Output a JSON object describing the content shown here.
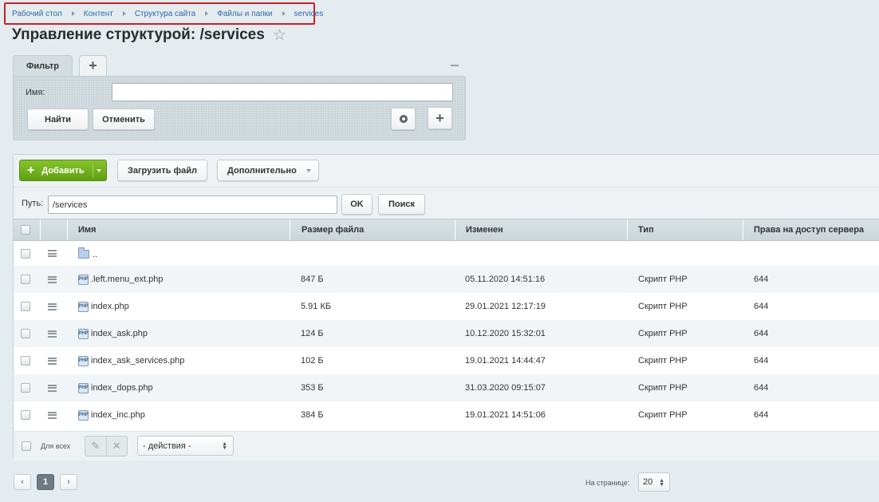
{
  "breadcrumb": [
    "Рабочий стол",
    "Контент",
    "Структура сайта",
    "Файлы и папки",
    "services"
  ],
  "page_title": "Управление структурой: /services",
  "filter": {
    "tab_label": "Фильтр",
    "add_tab": "+",
    "name_label": "Имя:",
    "name_value": "",
    "find_button": "Найти",
    "cancel_button": "Отменить"
  },
  "toolbar": {
    "add_button": "Добавить",
    "upload_button": "Загрузить файл",
    "more_button": "Дополнительно"
  },
  "path": {
    "label": "Путь:",
    "value": "/services",
    "ok_button": "OK",
    "search_button": "Поиск"
  },
  "columns": [
    "Имя",
    "Размер файла",
    "Изменен",
    "Тип",
    "Права на доступ сервера"
  ],
  "parent_row": "..",
  "rows": [
    {
      "name": ".left.menu_ext.php",
      "size": "847 Б",
      "modified": "05.11.2020 14:51:16",
      "type": "Скрипт PHP",
      "perms": "644"
    },
    {
      "name": "index.php",
      "size": "5.91 КБ",
      "modified": "29.01.2021 12:17:19",
      "type": "Скрипт PHP",
      "perms": "644"
    },
    {
      "name": "index_ask.php",
      "size": "124 Б",
      "modified": "10.12.2020 15:32:01",
      "type": "Скрипт PHP",
      "perms": "644"
    },
    {
      "name": "index_ask_services.php",
      "size": "102 Б",
      "modified": "19.01.2021 14:44:47",
      "type": "Скрипт PHP",
      "perms": "644"
    },
    {
      "name": "index_dops.php",
      "size": "353 Б",
      "modified": "31.03.2020 09:15:07",
      "type": "Скрипт PHP",
      "perms": "644"
    },
    {
      "name": "index_inc.php",
      "size": "384 Б",
      "modified": "19.01.2021 14:51:06",
      "type": "Скрипт PHP",
      "perms": "644"
    }
  ],
  "footer": {
    "for_all": "Для всех",
    "actions_select": "- действия -"
  },
  "pagination": {
    "current_page": "1",
    "per_page_label": "На странице:",
    "per_page_value": "20"
  },
  "icons": {
    "php_icon_glyph": "PHP"
  },
  "colors": {
    "accent_green": "#6aad1c",
    "breadcrumb_link": "#2f69a5",
    "highlight_border": "#c8202a"
  }
}
